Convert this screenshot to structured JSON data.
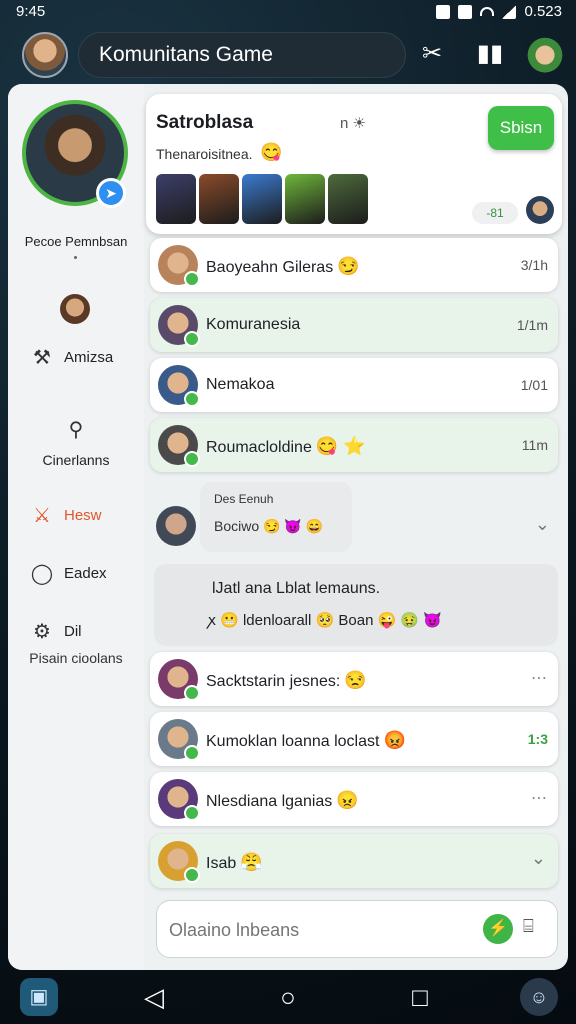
{
  "status_bar": {
    "time": "9:45",
    "battery": "0.523"
  },
  "header": {
    "title": "Komunitans Game"
  },
  "sidebar": {
    "profile_name": "Pecoe Pemnbsan",
    "items": [
      {
        "label": "Amizsa",
        "icon": "sword-icon"
      },
      {
        "label": "Cinerlanns",
        "icon": "search-icon"
      },
      {
        "label": "Hesw",
        "icon": "cross-swords-icon"
      },
      {
        "label": "Eadex",
        "icon": "circle-icon"
      },
      {
        "label": "Dil",
        "icon": "share-icon"
      }
    ],
    "sub_label": "Pisain cioolans"
  },
  "feature": {
    "title": "Satroblasa",
    "meta": "n ☀",
    "subtitle": "Thenaroisitnea.",
    "send_label": "Sbisn",
    "count": "-81",
    "heroes": [
      "#3d3f6b",
      "#8a4b2a",
      "#3b7bd1",
      "#6fb63a",
      "#4d6b3c"
    ]
  },
  "rows": [
    {
      "name": "Baoyeahn Gileras",
      "emoji": "😏",
      "time": "3/1h",
      "tint": false,
      "color": "#b8835a"
    },
    {
      "name": "Komuranesia",
      "emoji": "",
      "time": "1/1m",
      "tint": true,
      "color": "#5a4a6a"
    },
    {
      "name": "Nemakoa",
      "emoji": "",
      "time": "1/01",
      "tint": false,
      "color": "#3a5a8a"
    },
    {
      "name": "Roumacloldine",
      "emoji": "😋 ⭐",
      "time": "11m",
      "tint": true,
      "color": "#4a4a4a"
    },
    {
      "name": "Sacktstarin jesnes:",
      "emoji": "😒",
      "time": "",
      "tint": false,
      "color": "#7a3a6a",
      "dots": true
    },
    {
      "name": "Kumoklan loanna loclast",
      "emoji": "😡",
      "time": "1:3",
      "tint": false,
      "color": "#6a7a8a",
      "green": true
    },
    {
      "name": "Nlesdiana lganias",
      "emoji": "😠",
      "time": "",
      "tint": false,
      "color": "#5a3a7a",
      "dots": true
    },
    {
      "name": "Isab",
      "emoji": "😤",
      "time": "",
      "tint": true,
      "color": "#d8a030",
      "chevron": true
    }
  ],
  "expanded": {
    "line1": "Des Eenuh",
    "line2": "Bociwo",
    "emojis": "😏 😈 😄"
  },
  "notice": {
    "line1": "lJatl ana Lblat lemauns.",
    "line2_prefix": "ꭗ 😬",
    "line2_text": "ldenloarall",
    "line2_suffix": "🥺 Boan 😜 🤢 😈"
  },
  "input": {
    "placeholder": "Olaaino lnbeans"
  },
  "navbar": {
    "back": "◁",
    "home": "○",
    "recent": "□"
  }
}
